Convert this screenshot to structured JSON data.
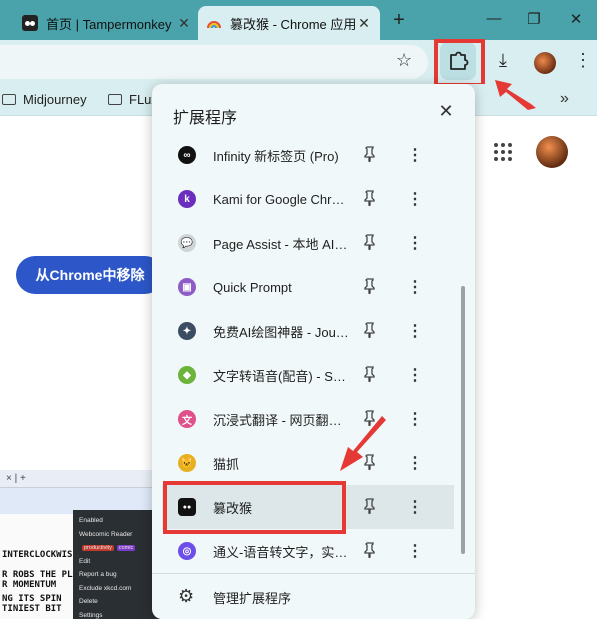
{
  "tabs": [
    {
      "title": "首页 | Tampermonkey",
      "active": false
    },
    {
      "title": "篡改猴 - Chrome 应用商店",
      "active": true
    }
  ],
  "window_controls": {
    "new_tab": "+",
    "minimize": "—",
    "restore": "❐",
    "close": "✕"
  },
  "toolbar": {
    "star": "☆",
    "download": "⤓",
    "menu": "⋮"
  },
  "bookmarks": {
    "items": [
      "Midjourney",
      "FLux"
    ],
    "more": "»"
  },
  "page": {
    "remove_button": "从Chrome中移除"
  },
  "extensions_popup": {
    "title": "扩展程序",
    "close": "✕",
    "items": [
      {
        "name": "Infinity 新标签页 (Pro)",
        "icon": "infinity-icon",
        "color": "#111111",
        "glyph": "∞"
      },
      {
        "name": "Kami for Google Chrome",
        "icon": "kami-icon",
        "color": "#6a2fbf",
        "glyph": "k"
      },
      {
        "name": "Page Assist - 本地 AI 模型的 Web UI",
        "icon": "page-assist-icon",
        "color": "#cfd5d6",
        "glyph": "💬"
      },
      {
        "name": "Quick Prompt",
        "icon": "quick-prompt-icon",
        "color": "#8e5cc7",
        "glyph": "▣"
      },
      {
        "name": "免费AI绘图神器 - Journey",
        "icon": "ai-draw-icon",
        "color": "#3b4c63",
        "glyph": "✦"
      },
      {
        "name": "文字转语音(配音) - Speechify",
        "icon": "parrot-icon",
        "color": "#6bb33a",
        "glyph": "◆"
      },
      {
        "name": "沉浸式翻译 - 网页翻译插件",
        "icon": "immersive-translate-icon",
        "color": "#e0508a",
        "glyph": "文"
      },
      {
        "name": "猫抓",
        "icon": "cat-catch-icon",
        "color": "#e6b020",
        "glyph": "🐱"
      },
      {
        "name": "篡改猴",
        "icon": "tampermonkey-icon",
        "color": "#111111",
        "glyph": "●●",
        "selected": true
      },
      {
        "name": "通义-语音转文字，实时记录",
        "icon": "tongyi-icon",
        "color": "#6c4ee8",
        "glyph": "◎"
      }
    ],
    "pin": "📌",
    "more": "⋮",
    "manage_label": "管理扩展程序"
  },
  "embedded_screenshot": {
    "tab_bar": "× | +",
    "comic_lines": [
      "INTERCLOCKWISE",
      "R ROBS THE PLANET",
      "R MOMENTUM",
      "NG ITS SPIN",
      "TINIEST BIT"
    ],
    "menu": [
      {
        "label": "Enabled"
      },
      {
        "label": "Webcomic Reader",
        "tags": [
          "productivity",
          "comic"
        ]
      },
      {
        "label": "Edit"
      },
      {
        "label": "Report a bug"
      },
      {
        "label": "Exclude xkcd.com"
      },
      {
        "label": "Delete"
      },
      {
        "label": "Settings"
      }
    ]
  },
  "colors": {
    "highlight": "#e53935",
    "accent": "#2d57c8",
    "tab_strip": "#4aa3ab",
    "toolbar": "#d9eef0"
  }
}
